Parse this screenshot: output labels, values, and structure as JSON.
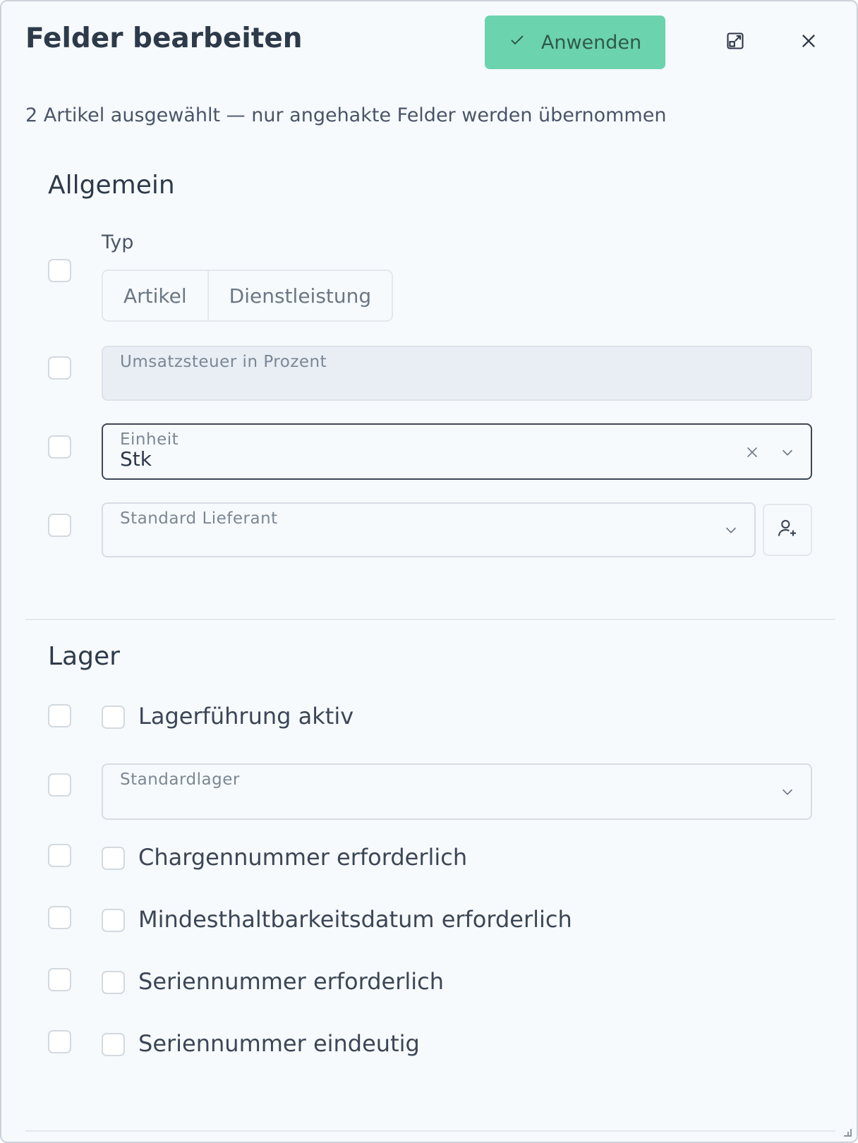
{
  "dialog": {
    "title": "Felder bearbeiten",
    "apply_label": "Anwenden",
    "subtitle": "2 Artikel ausgewählt — nur angehakte Felder werden übernommen",
    "accent_color": "#6cd3af"
  },
  "allgemein": {
    "section_title": "Allgemein",
    "typ": {
      "label": "Typ",
      "options": [
        "Artikel",
        "Dienstleistung"
      ]
    },
    "umsatzsteuer": {
      "label": "Umsatzsteuer in Prozent",
      "value": ""
    },
    "einheit": {
      "label": "Einheit",
      "value": "Stk"
    },
    "lieferant": {
      "label": "Standard Lieferant",
      "value": ""
    }
  },
  "lager": {
    "section_title": "Lager",
    "lagerfuehrung": "Lagerführung aktiv",
    "standardlager": {
      "label": "Standardlager",
      "value": ""
    },
    "charge": "Chargennummer erforderlich",
    "mhd": "Mindesthaltbarkeitsdatum erforderlich",
    "seriennummer": "Seriennummer erforderlich",
    "seriennummer_eindeutig": "Seriennummer eindeutig"
  },
  "icons": {
    "apply": "check-icon",
    "expand": "expand-icon",
    "close": "close-icon",
    "clear": "clear-icon",
    "dropdown": "chevron-down-icon",
    "add_supplier": "user-plus-icon"
  }
}
